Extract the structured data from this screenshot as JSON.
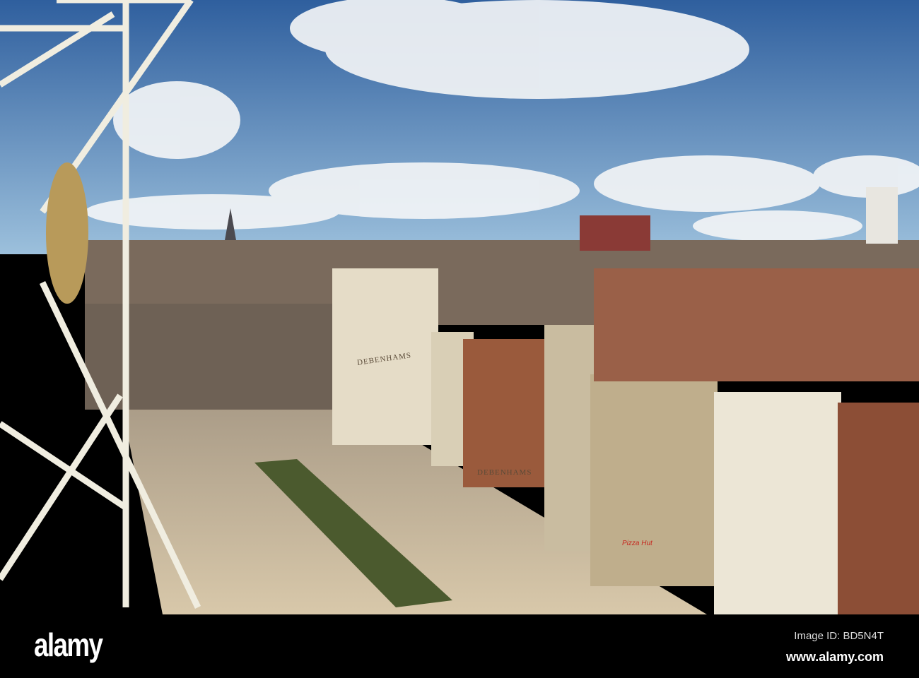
{
  "photo": {
    "signs": {
      "store_upper": "DEBENHAMS",
      "store_lower": "DEBENHAMS",
      "restaurant": "Pizza Hut"
    },
    "colors": {
      "sky_top": "#2f5f9e",
      "sky_bottom": "#8db4d8",
      "cloud": "#f2f4f6",
      "plaza": "#c9b79a",
      "facade": "#e5dcc7",
      "brick": "#9a5a3c",
      "frame": "#f0ede0"
    }
  },
  "footer": {
    "logo": "alamy",
    "image_id": "Image ID: BD5N4T",
    "website": "www.alamy.com"
  }
}
